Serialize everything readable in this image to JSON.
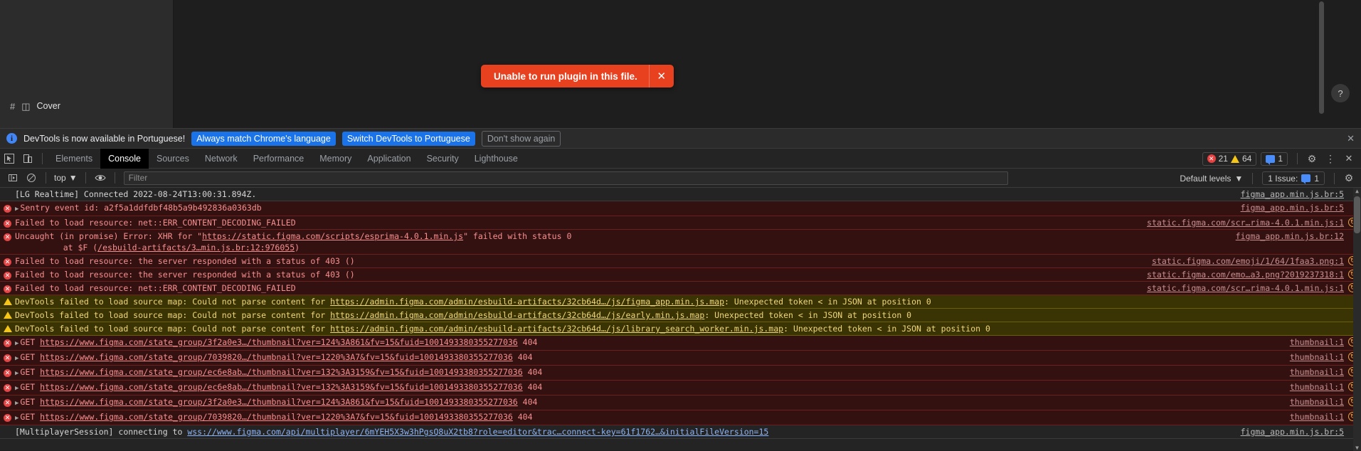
{
  "figma": {
    "layer_name": "Cover",
    "hash_icon": "hash-icon",
    "frame_icon": "frame-icon",
    "help_label": "?",
    "toast": {
      "message": "Unable to run plugin in this file.",
      "close_label": "✕",
      "bg_color": "#e8411f"
    }
  },
  "devtools": {
    "language_banner": {
      "message": "DevTools is now available in Portuguese!",
      "buttons": [
        {
          "label": "Always match Chrome's language",
          "style": "primary"
        },
        {
          "label": "Switch DevTools to Portuguese",
          "style": "primary"
        },
        {
          "label": "Don't show again",
          "style": "ghost"
        }
      ],
      "close_label": "✕",
      "accent_color": "#1a73e8"
    },
    "tabs": [
      {
        "label": "Elements",
        "active": false
      },
      {
        "label": "Console",
        "active": true
      },
      {
        "label": "Sources",
        "active": false
      },
      {
        "label": "Network",
        "active": false
      },
      {
        "label": "Performance",
        "active": false
      },
      {
        "label": "Memory",
        "active": false
      },
      {
        "label": "Application",
        "active": false
      },
      {
        "label": "Security",
        "active": false
      },
      {
        "label": "Lighthouse",
        "active": false
      }
    ],
    "tabbar_right": {
      "error_count": "21",
      "warning_count": "64",
      "message_count": "1",
      "settings_label": "⚙",
      "more_label": "⋮",
      "close_label": "✕"
    },
    "console_toolbar": {
      "context": "top",
      "filter_placeholder": "Filter",
      "filter_value": "",
      "levels": "Default levels",
      "issues_label": "1 Issue:",
      "issues_count": "1",
      "settings_label": "⚙"
    },
    "logs": [
      {
        "level": "info",
        "expandable": false,
        "parts": [
          {
            "t": "text",
            "v": "[LG Realtime] Connected 2022-08-24T13:00:31.894Z."
          }
        ],
        "source": "figma_app.min.js.br:5",
        "badge": false
      },
      {
        "level": "error",
        "expandable": true,
        "parts": [
          {
            "t": "text",
            "v": "Sentry event id: a2f5a1ddfdbf48b5a9b492836a0363db"
          }
        ],
        "source": "figma_app.min.js.br:5",
        "badge": false
      },
      {
        "level": "error",
        "expandable": false,
        "parts": [
          {
            "t": "text",
            "v": "Failed to load resource: net::ERR_CONTENT_DECODING_FAILED"
          }
        ],
        "source": "static.figma.com/scr…rima-4.0.1.min.js:1",
        "badge": true
      },
      {
        "level": "error",
        "expandable": false,
        "parts": [
          {
            "t": "text",
            "v": "Uncaught (in promise) Error: XHR for \""
          },
          {
            "t": "link",
            "v": "https://static.figma.com/scripts/esprima-4.0.1.min.js"
          },
          {
            "t": "text",
            "v": "\" failed with status 0"
          }
        ],
        "stack": [
          {
            "pre": "    at $F (",
            "link": "/esbuild-artifacts/3…min.js.br:12:976055",
            "post": ")"
          }
        ],
        "source": "figma_app.min.js.br:12",
        "badge": false
      },
      {
        "level": "error",
        "expandable": false,
        "parts": [
          {
            "t": "text",
            "v": "Failed to load resource: the server responded with a status of 403 ()"
          }
        ],
        "source": "static.figma.com/emoji/1/64/1faa3.png:1",
        "badge": true
      },
      {
        "level": "error",
        "expandable": false,
        "parts": [
          {
            "t": "text",
            "v": "Failed to load resource: the server responded with a status of 403 ()"
          }
        ],
        "source": "static.figma.com/emo…a3.png?2019237318:1",
        "badge": true
      },
      {
        "level": "error",
        "expandable": false,
        "parts": [
          {
            "t": "text",
            "v": "Failed to load resource: net::ERR_CONTENT_DECODING_FAILED"
          }
        ],
        "source": "static.figma.com/scr…rima-4.0.1.min.js:1",
        "badge": true
      },
      {
        "level": "warn",
        "expandable": false,
        "parts": [
          {
            "t": "text",
            "v": "DevTools failed to load source map: Could not parse content for "
          },
          {
            "t": "link",
            "v": "https://admin.figma.com/admin/esbuild-artifacts/32cb64d…/js/figma_app.min.js.map"
          },
          {
            "t": "text",
            "v": ": Unexpected token < in JSON at position 0"
          }
        ],
        "source": "",
        "badge": false
      },
      {
        "level": "warn",
        "expandable": false,
        "parts": [
          {
            "t": "text",
            "v": "DevTools failed to load source map: Could not parse content for "
          },
          {
            "t": "link",
            "v": "https://admin.figma.com/admin/esbuild-artifacts/32cb64d…/js/early.min.js.map"
          },
          {
            "t": "text",
            "v": ": Unexpected token < in JSON at position 0"
          }
        ],
        "source": "",
        "badge": false
      },
      {
        "level": "warn",
        "expandable": false,
        "parts": [
          {
            "t": "text",
            "v": "DevTools failed to load source map: Could not parse content for "
          },
          {
            "t": "link",
            "v": "https://admin.figma.com/admin/esbuild-artifacts/32cb64d…/js/library_search_worker.min.js.map"
          },
          {
            "t": "text",
            "v": ": Unexpected token < in JSON at position 0"
          }
        ],
        "source": "",
        "badge": false
      },
      {
        "level": "error",
        "expandable": true,
        "parts": [
          {
            "t": "text",
            "v": "GET "
          },
          {
            "t": "link",
            "v": "https://www.figma.com/state_group/3f2a0e3…/thumbnail?ver=124%3A861&fv=15&fuid=1001493380355277036"
          },
          {
            "t": "text",
            "v": " 404"
          }
        ],
        "source": "thumbnail:1",
        "badge": true
      },
      {
        "level": "error",
        "expandable": true,
        "parts": [
          {
            "t": "text",
            "v": "GET "
          },
          {
            "t": "link",
            "v": "https://www.figma.com/state_group/7039820…/thumbnail?ver=1220%3A7&fv=15&fuid=1001493380355277036"
          },
          {
            "t": "text",
            "v": " 404"
          }
        ],
        "source": "thumbnail:1",
        "badge": true
      },
      {
        "level": "error",
        "expandable": true,
        "parts": [
          {
            "t": "text",
            "v": "GET "
          },
          {
            "t": "link",
            "v": "https://www.figma.com/state_group/ec6e8ab…/thumbnail?ver=132%3A3159&fv=15&fuid=1001493380355277036"
          },
          {
            "t": "text",
            "v": " 404"
          }
        ],
        "source": "thumbnail:1",
        "badge": true
      },
      {
        "level": "error",
        "expandable": true,
        "parts": [
          {
            "t": "text",
            "v": "GET "
          },
          {
            "t": "link",
            "v": "https://www.figma.com/state_group/ec6e8ab…/thumbnail?ver=132%3A3159&fv=15&fuid=1001493380355277036"
          },
          {
            "t": "text",
            "v": " 404"
          }
        ],
        "source": "thumbnail:1",
        "badge": true
      },
      {
        "level": "error",
        "expandable": true,
        "parts": [
          {
            "t": "text",
            "v": "GET "
          },
          {
            "t": "link",
            "v": "https://www.figma.com/state_group/3f2a0e3…/thumbnail?ver=124%3A861&fv=15&fuid=1001493380355277036"
          },
          {
            "t": "text",
            "v": " 404"
          }
        ],
        "source": "thumbnail:1",
        "badge": true
      },
      {
        "level": "error",
        "expandable": true,
        "parts": [
          {
            "t": "text",
            "v": "GET "
          },
          {
            "t": "link",
            "v": "https://www.figma.com/state_group/7039820…/thumbnail?ver=1220%3A7&fv=15&fuid=1001493380355277036"
          },
          {
            "t": "text",
            "v": " 404"
          }
        ],
        "source": "thumbnail:1",
        "badge": true
      },
      {
        "level": "info",
        "expandable": false,
        "parts": [
          {
            "t": "text",
            "v": "[MultiplayerSession] connecting to "
          },
          {
            "t": "link",
            "v": "wss://www.figma.com/api/multiplayer/6mYEH5X3w3hPgsQ8uX2tb8?role=editor&trac…connect-key=61f1762…&initialFileVersion=15"
          }
        ],
        "source": "figma_app.min.js.br:5",
        "badge": false
      }
    ]
  }
}
